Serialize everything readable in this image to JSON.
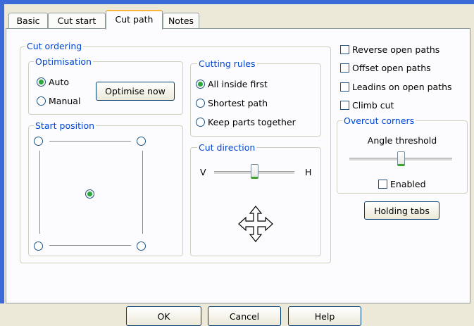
{
  "tabs": [
    {
      "label": "Basic"
    },
    {
      "label": "Cut start"
    },
    {
      "label": "Cut path"
    },
    {
      "label": "Notes"
    }
  ],
  "cut_ordering": {
    "label": "Cut ordering",
    "optimisation": {
      "label": "Optimisation",
      "auto_label": "Auto",
      "manual_label": "Manual",
      "selected": "Auto",
      "optimise_button": "Optimise now"
    },
    "start_position": {
      "label": "Start position",
      "selected": "center"
    },
    "cutting_rules": {
      "label": "Cutting rules",
      "options": [
        "All inside first",
        "Shortest path",
        "Keep parts together"
      ],
      "selected": "All inside first"
    },
    "cut_direction": {
      "label": "Cut direction",
      "left_label": "V",
      "right_label": "H",
      "slider_value": 0.5
    }
  },
  "options": {
    "reverse_open_paths": {
      "label": "Reverse open paths",
      "checked": false
    },
    "offset_open_paths": {
      "label": "Offset open paths",
      "checked": false
    },
    "leadins_open_paths": {
      "label": "Leadins on open paths",
      "checked": false
    },
    "climb_cut": {
      "label": "Climb cut",
      "checked": false
    }
  },
  "overcut_corners": {
    "label": "Overcut corners",
    "angle_label": "Angle threshold",
    "slider_value": 0.5,
    "enabled_label": "Enabled",
    "enabled": false
  },
  "holding_tabs_button": "Holding tabs",
  "footer": {
    "ok": "OK",
    "cancel": "Cancel",
    "help": "Help"
  },
  "colors": {
    "accent_green": "#2aa73a",
    "legend_blue": "#0046d5",
    "active_tab_top": "#f8b53a"
  }
}
